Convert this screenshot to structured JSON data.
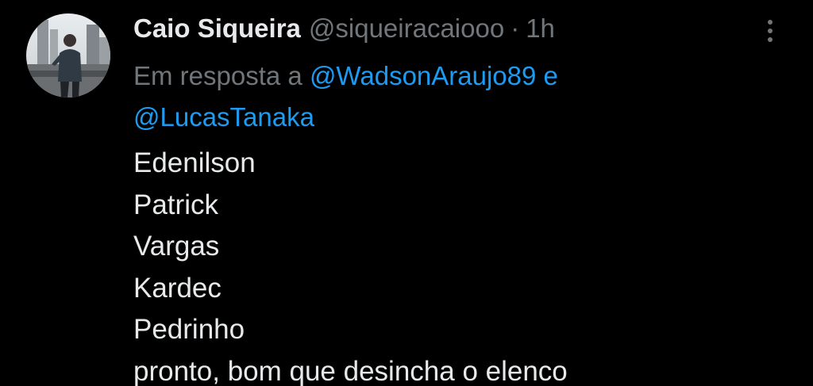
{
  "tweet": {
    "display_name": "Caio Siqueira",
    "handle": "@siqueiracaiooo",
    "separator": "·",
    "time": "1h",
    "reply_prefix": "Em resposta a",
    "reply_mentions": [
      "@WadsonAraujo89",
      "@LucasTanaka"
    ],
    "reply_joiner": "e",
    "lines": [
      "Edenilson",
      "Patrick",
      "Vargas",
      "Kardec",
      "Pedrinho",
      "pronto, bom que desincha o elenco"
    ]
  },
  "icons": {
    "avatar": "profile-photo",
    "more": "more-vertical-icon"
  },
  "colors": {
    "background": "#000000",
    "primary_text": "#e7e9ea",
    "secondary_text": "#71767b",
    "link": "#1d9bf0"
  }
}
